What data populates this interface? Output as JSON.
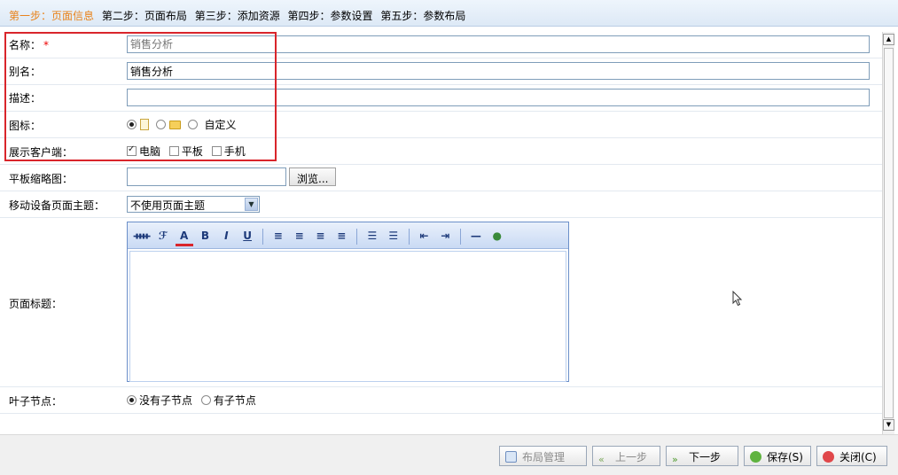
{
  "steps": [
    {
      "label": "第一步：页面信息",
      "active": true
    },
    {
      "label": "第二步：页面布局",
      "active": false
    },
    {
      "label": "第三步：添加资源",
      "active": false
    },
    {
      "label": "第四步：参数设置",
      "active": false
    },
    {
      "label": "第五步：参数布局",
      "active": false
    }
  ],
  "form": {
    "name": {
      "label": "名称：",
      "required_mark": "*",
      "placeholder": "销售分析"
    },
    "alias": {
      "label": "别名：",
      "value": "销售分析"
    },
    "description": {
      "label": "描述：",
      "value": ""
    },
    "icon": {
      "label": "图标：",
      "custom_label": "自定义",
      "selected": "page"
    },
    "clients": {
      "label": "展示客户端：",
      "options": [
        {
          "label": "电脑",
          "checked": true
        },
        {
          "label": "平板",
          "checked": false
        },
        {
          "label": "手机",
          "checked": false
        }
      ]
    },
    "tablet_thumb": {
      "label": "平板缩略图：",
      "value": "",
      "browse_label": "浏览..."
    },
    "mobile_theme": {
      "label": "移动设备页面主题：",
      "selected": "不使用页面主题"
    },
    "page_title": {
      "label": "页面标题："
    },
    "leaf_node": {
      "label": "叶子节点：",
      "options": [
        {
          "label": "没有子节点",
          "checked": true
        },
        {
          "label": "有子节点",
          "checked": false
        }
      ]
    }
  },
  "editor_toolbar": {
    "font_family": "ᚓ",
    "font_style": "ℱ",
    "font_color": "A",
    "bold": "B",
    "italic": "I",
    "underline": "U",
    "align_left": "≡",
    "align_center": "≡",
    "align_right": "≡",
    "justify": "≡",
    "ordered_list": "☰",
    "unordered_list": "☰",
    "outdent": "⇤",
    "indent": "⇥",
    "hr": "—",
    "link": "●"
  },
  "footer": {
    "layout_manage": "布局管理",
    "prev": "上一步",
    "next": "下一步",
    "save": "保存(S)",
    "close": "关闭(C)"
  },
  "colors": {
    "active_step": "#e8831b",
    "highlight": "#d9252b",
    "required": "#e00000"
  }
}
